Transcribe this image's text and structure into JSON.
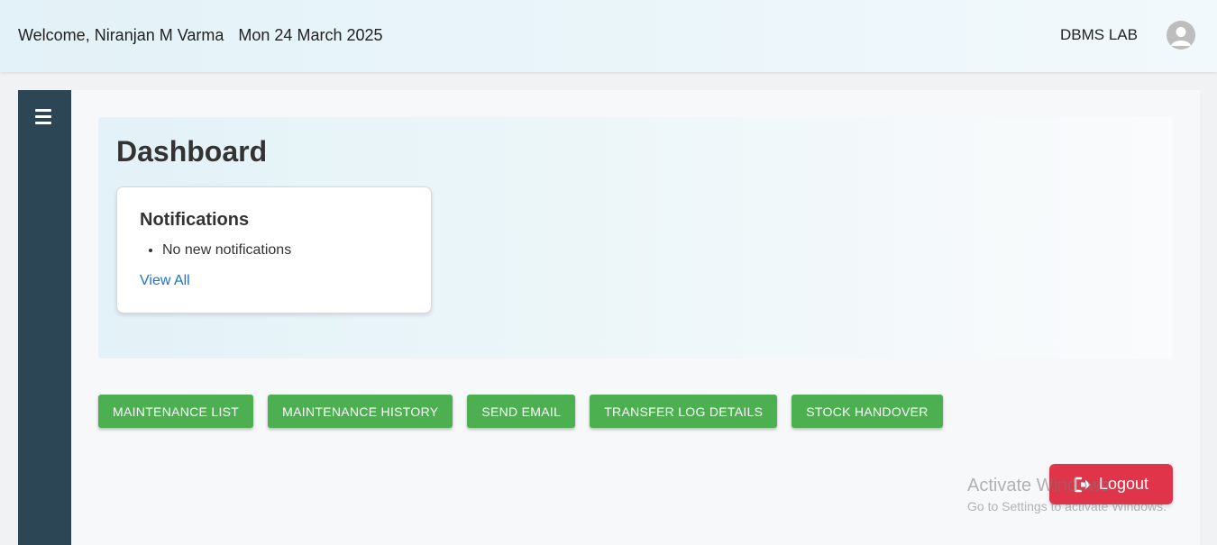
{
  "header": {
    "welcome_text": "Welcome, Niranjan M Varma",
    "date_text": "Mon 24 March 2025",
    "lab_name": "DBMS LAB",
    "avatar_icon": "user-avatar-icon"
  },
  "sidebar": {
    "menu_icon": "hamburger-menu-icon"
  },
  "dashboard": {
    "title": "Dashboard",
    "notifications": {
      "title": "Notifications",
      "items": [
        "No new notifications"
      ],
      "view_all_label": "View All"
    }
  },
  "actions": [
    {
      "label": "MAINTENANCE LIST"
    },
    {
      "label": "MAINTENANCE HISTORY"
    },
    {
      "label": "SEND EMAIL"
    },
    {
      "label": "TRANSFER LOG DETAILS"
    },
    {
      "label": "STOCK HANDOVER"
    }
  ],
  "logout": {
    "label": "Logout",
    "icon": "logout-icon"
  },
  "watermark": {
    "title": "Activate Windows",
    "subtitle": "Go to Settings to activate Windows."
  },
  "colors": {
    "sidebar": "#2d4656",
    "action_button": "#4caf50",
    "logout_button": "#e0344a",
    "link": "#1a73c8"
  }
}
